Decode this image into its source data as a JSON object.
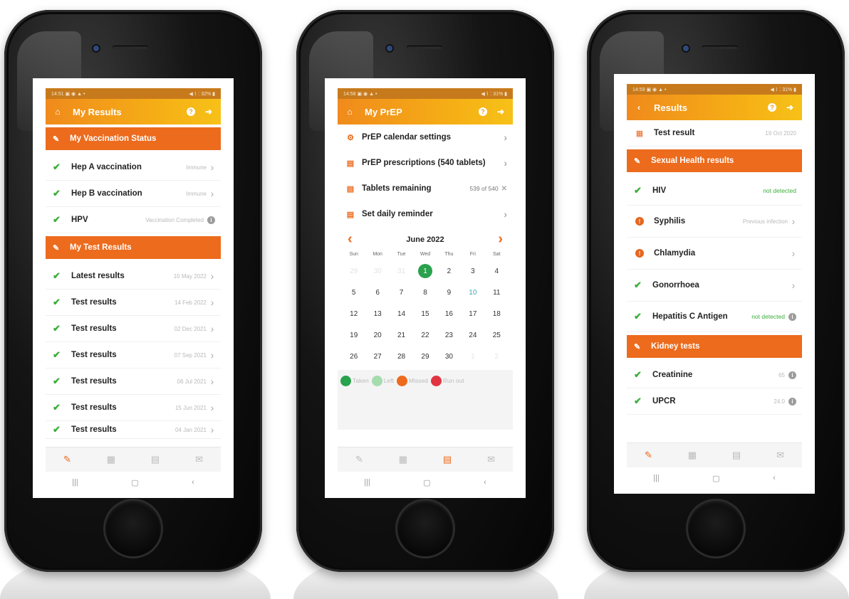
{
  "colors": {
    "accent": "#ec6b1d",
    "header_gradient_start": "#f08a1c",
    "header_gradient_end": "#f7c117",
    "success": "#3aae3a"
  },
  "phone1": {
    "status": {
      "time": "14:51 ▣ ◉ ▲ •",
      "right": "◀ ⌇ ⁚ 32% ▮"
    },
    "header": {
      "title": "My Results",
      "home_icon": "home-icon",
      "help_icon": "help-icon",
      "logout_icon": "logout-icon"
    },
    "vaccination": {
      "title": "My Vaccination Status",
      "items": [
        {
          "label": "Hep A vaccination",
          "value": "Immune"
        },
        {
          "label": "Hep B vaccination",
          "value": "Immune"
        },
        {
          "label": "HPV",
          "value": "Vaccination Completed"
        }
      ]
    },
    "tests": {
      "title": "My Test Results",
      "items": [
        {
          "label": "Latest results",
          "value": "10 May 2022"
        },
        {
          "label": "Test results",
          "value": "14 Feb 2022"
        },
        {
          "label": "Test results",
          "value": "02 Dec 2021"
        },
        {
          "label": "Test results",
          "value": "07 Sep 2021"
        },
        {
          "label": "Test results",
          "value": "06 Jul 2021"
        },
        {
          "label": "Test results",
          "value": "15 Jun 2021"
        },
        {
          "label": "Test results",
          "value": "04 Jan 2021"
        }
      ]
    }
  },
  "phone2": {
    "status": {
      "time": "14:58 ▣ ◉ ▲ •",
      "right": "◀ ⌇ ⁚ 31% ▮"
    },
    "header": {
      "title": "My PrEP"
    },
    "menu": {
      "calendar_settings": "PrEP calendar settings",
      "prescriptions": "PrEP prescriptions (540 tablets)",
      "tablets_remaining": "Tablets remaining",
      "tablets_value": "539 of 540",
      "daily_reminder": "Set daily reminder"
    },
    "calendar": {
      "month": "June 2022",
      "dow": [
        "Sun",
        "Mon",
        "Tue",
        "Wed",
        "Thu",
        "Fri",
        "Sat"
      ],
      "leading_days": [
        "29",
        "30",
        "31"
      ],
      "days": [
        "1",
        "2",
        "3",
        "4",
        "5",
        "6",
        "7",
        "8",
        "9",
        "10",
        "11",
        "12",
        "13",
        "14",
        "15",
        "16",
        "17",
        "18",
        "19",
        "20",
        "21",
        "22",
        "23",
        "24",
        "25",
        "26",
        "27",
        "28",
        "29",
        "30"
      ],
      "trailing_days": [
        "1",
        "2"
      ],
      "today": "1",
      "highlight": "10"
    },
    "legend": {
      "taken": "Taken",
      "left": "Left",
      "missed": "Missed",
      "run_out": "Run out"
    }
  },
  "phone3": {
    "status": {
      "time": "14:59 ▣ ◉ ▲ •",
      "right": "◀ ⌇ ⁚ 31% ▮"
    },
    "header": {
      "title": "Results"
    },
    "test_result": {
      "label": "Test result",
      "value": "19 Oct 2020"
    },
    "sexual_health": {
      "title": "Sexual Health results",
      "items": [
        {
          "label": "HIV",
          "value": "not detected"
        },
        {
          "label": "Syphilis",
          "value": "Previous infection"
        },
        {
          "label": "Chlamydia",
          "value": ""
        },
        {
          "label": "Gonorrhoea",
          "value": ""
        },
        {
          "label": "Hepatitis C Antigen",
          "value": "not detected"
        }
      ]
    },
    "kidney": {
      "title": "Kidney tests",
      "items": [
        {
          "label": "Creatinine",
          "value": "65"
        },
        {
          "label": "UPCR",
          "value": "24.0"
        }
      ]
    }
  }
}
